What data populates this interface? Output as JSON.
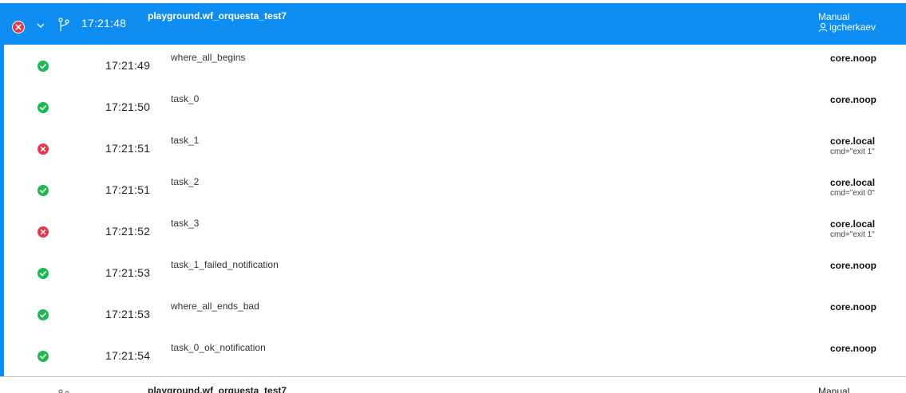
{
  "execution": {
    "status_icon": "error-circle-icon",
    "expand_icon": "chevron-down-icon",
    "branch_icon": "workflow-branch-icon",
    "time": "17:21:48",
    "title": "playground.wf_orquesta_test7",
    "mode": "Manual",
    "user": "igcherkaev",
    "user_icon": "user-icon",
    "colors": {
      "header": "#0d8df2",
      "success": "#1db954",
      "failure": "#e03a4a"
    }
  },
  "tasks": [
    {
      "status": "succeeded",
      "time": "17:21:49",
      "name": "where_all_begins",
      "action": "core.noop",
      "param": ""
    },
    {
      "status": "succeeded",
      "time": "17:21:50",
      "name": "task_0",
      "action": "core.noop",
      "param": ""
    },
    {
      "status": "failed",
      "time": "17:21:51",
      "name": "task_1",
      "action": "core.local",
      "param": "cmd=\"exit 1\""
    },
    {
      "status": "succeeded",
      "time": "17:21:51",
      "name": "task_2",
      "action": "core.local",
      "param": "cmd=\"exit 0\""
    },
    {
      "status": "failed",
      "time": "17:21:52",
      "name": "task_3",
      "action": "core.local",
      "param": "cmd=\"exit 1\""
    },
    {
      "status": "succeeded",
      "time": "17:21:53",
      "name": "task_1_failed_notification",
      "action": "core.noop",
      "param": ""
    },
    {
      "status": "succeeded",
      "time": "17:21:53",
      "name": "where_all_ends_bad",
      "action": "core.noop",
      "param": ""
    },
    {
      "status": "succeeded",
      "time": "17:21:54",
      "name": "task_0_ok_notification",
      "action": "core.noop",
      "param": ""
    }
  ],
  "next_execution": {
    "title": "playground.wf_orquesta_test7",
    "mode": "Manual"
  }
}
